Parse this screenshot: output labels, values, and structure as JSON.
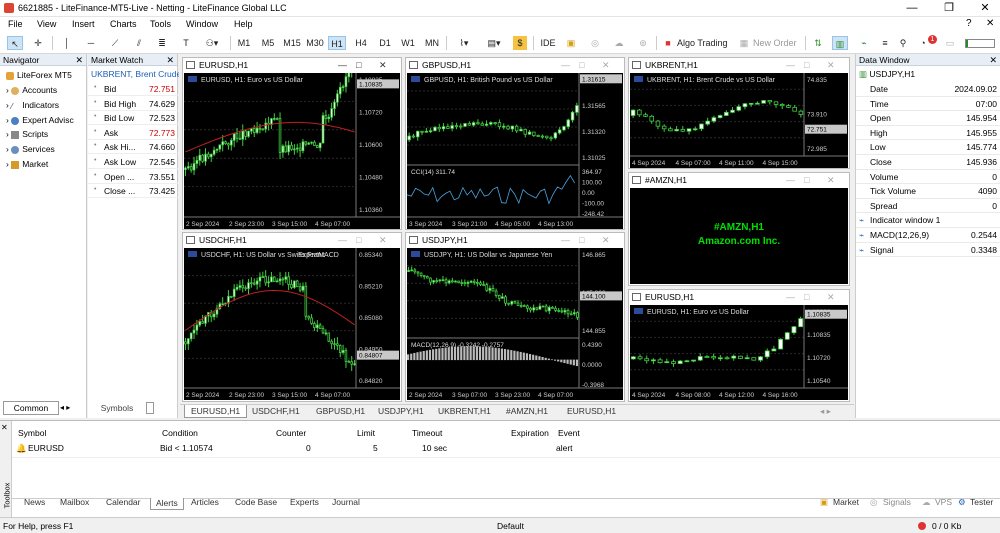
{
  "window": {
    "title": "6621885 - LiteFinance-MT5-Live - Netting - LiteFinance Global LLC"
  },
  "menu": [
    "File",
    "View",
    "Insert",
    "Charts",
    "Tools",
    "Window",
    "Help"
  ],
  "toolbar": {
    "timeframes": [
      "M1",
      "M5",
      "M15",
      "M30",
      "H1",
      "H4",
      "D1",
      "W1",
      "MN"
    ],
    "ide": "IDE",
    "algo": "Algo Trading",
    "new_order": "New Order",
    "badge": "1"
  },
  "navigator": {
    "title": "Navigator",
    "root": "LiteForex MT5",
    "items": [
      "Accounts",
      "Indicators",
      "Expert Advisc",
      "Scripts",
      "Services",
      "Market"
    ],
    "tabs": [
      "Common"
    ]
  },
  "market_watch": {
    "title": "Market Watch",
    "symbol": "UKBRENT, Brent Crude",
    "rows": [
      {
        "name": "Bid",
        "value": "72.751",
        "color": "red"
      },
      {
        "name": "Bid High",
        "value": "74.629",
        "color": ""
      },
      {
        "name": "Bid Low",
        "value": "72.523",
        "color": ""
      },
      {
        "name": "Ask",
        "value": "72.773",
        "color": "red"
      },
      {
        "name": "Ask Hi...",
        "value": "74.660",
        "color": ""
      },
      {
        "name": "Ask Low",
        "value": "72.545",
        "color": ""
      },
      {
        "name": "Open ...",
        "value": "73.551",
        "color": ""
      },
      {
        "name": "Close ...",
        "value": "73.425",
        "color": ""
      }
    ],
    "tabs": [
      "Symbols"
    ]
  },
  "charts": {
    "eurusd": {
      "title": "EURUSD,H1",
      "caption": "EURUSD, H1:  Euro vs US Dollar",
      "prices": [
        "1.10835",
        "1.10720",
        "1.10600",
        "1.10480",
        "1.10360"
      ],
      "last": "1.10835",
      "times": [
        "2 Sep 2024",
        "2 Sep 23:00",
        "3 Sep 15:00",
        "4 Sep 07:00"
      ]
    },
    "gbpusd": {
      "title": "GBPUSD,H1",
      "caption": "GBPUSD, H1:  British Pound vs US Dollar",
      "prices": [
        "1.31615",
        "1.31565",
        "1.31320",
        "1.31025"
      ],
      "last": "1.31615",
      "ind": "CCI(14) 311.74",
      "ind_levels": [
        "364.97",
        "100.00",
        "0.00",
        "-100.00",
        "-248.42"
      ],
      "times": [
        "3 Sep 2024",
        "3 Sep 21:00",
        "4 Sep 05:00",
        "4 Sep 13:00"
      ]
    },
    "ukbrent": {
      "title": "UKBRENT,H1",
      "caption": "UKBRENT, H1:  Brent Crude vs US Dollar",
      "prices": [
        "74.835",
        "73.910",
        "72.985"
      ],
      "last": "72.751",
      "times": [
        "4 Sep 2024",
        "4 Sep 07:00",
        "4 Sep 11:00",
        "4 Sep 15:00"
      ]
    },
    "amzn": {
      "title": "#AMZN,H1",
      "line1": "#AMZN,H1",
      "line2": "Amazon.com Inc."
    },
    "usdchf": {
      "title": "USDCHF,H1",
      "caption": "USDCHF, H1:  US Dollar vs Swiss Franc",
      "prices": [
        "0.85340",
        "0.85210",
        "0.85080",
        "0.84950",
        "0.84820"
      ],
      "last": "0.84807",
      "times": [
        "2 Sep 2024",
        "2 Sep 23:00",
        "3 Sep 15:00",
        "4 Sep 07:00"
      ],
      "overlay": "ExpertMACD"
    },
    "usdjpy": {
      "title": "USDJPY,H1",
      "caption": "USDJPY, H1:  US Dollar vs Japanese Yen",
      "prices": [
        "146.865",
        "145.860",
        "144.855"
      ],
      "last": "144.100",
      "ind": "MACD(12,26,9) -0.3242 -0.2757",
      "ind_levels": [
        "0.4390",
        "0.0000",
        "-0.3968"
      ],
      "times": [
        "2 Sep 2024",
        "3 Sep 07:00",
        "3 Sep 23:00",
        "4 Sep 07:00"
      ]
    },
    "eurusd2": {
      "title": "EURUSD,H1",
      "caption": "EURUSD, H1:  Euro vs US Dollar",
      "prices": [
        "1.10900",
        "1.10835",
        "1.10720",
        "1.10540"
      ],
      "last": "1.10835",
      "times": [
        "4 Sep 2024",
        "4 Sep 08:00",
        "4 Sep 12:00",
        "4 Sep 16:00"
      ]
    }
  },
  "chart_tabs": [
    "EURUSD,H1",
    "USDCHF,H1",
    "GBPUSD,H1",
    "USDJPY,H1",
    "UKBRENT,H1",
    "#AMZN,H1",
    "EURUSD,H1"
  ],
  "data_window": {
    "title": "Data Window",
    "symbol": "USDJPY,H1",
    "rows": [
      {
        "k": "Date",
        "v": "2024.09.02"
      },
      {
        "k": "Time",
        "v": "07:00"
      },
      {
        "k": "Open",
        "v": "145.954"
      },
      {
        "k": "High",
        "v": "145.955"
      },
      {
        "k": "Low",
        "v": "145.774"
      },
      {
        "k": "Close",
        "v": "145.936"
      },
      {
        "k": "Volume",
        "v": "0"
      },
      {
        "k": "Tick Volume",
        "v": "4090"
      },
      {
        "k": "Spread",
        "v": "0"
      },
      {
        "k": "Indicator window 1",
        "v": ""
      },
      {
        "k": "MACD(12,26,9)",
        "v": "0.2544"
      },
      {
        "k": "Signal",
        "v": "0.3348"
      }
    ]
  },
  "alerts": {
    "headers": [
      "Symbol",
      "Condition",
      "Counter",
      "Limit",
      "Timeout",
      "Expiration",
      "Event"
    ],
    "row": [
      "EURUSD",
      "Bid < 1.10574",
      "0",
      "5",
      "10 sec",
      "",
      "alert"
    ]
  },
  "toolbox": {
    "side_label": "Toolbox",
    "tabs": [
      "News",
      "Mailbox",
      "Calendar",
      "Alerts",
      "Articles",
      "Code Base",
      "Experts",
      "Journal"
    ],
    "right": [
      "Market",
      "Signals",
      "VPS",
      "Tester"
    ]
  },
  "status": {
    "left": "For Help, press F1",
    "mid": "Default",
    "right": "0 / 0 Kb"
  }
}
